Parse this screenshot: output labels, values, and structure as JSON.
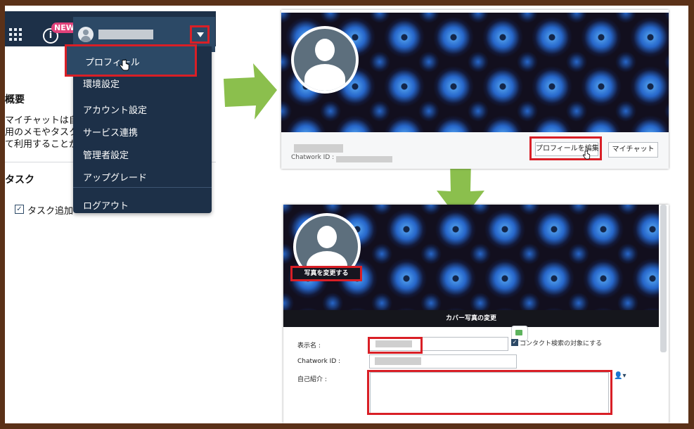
{
  "topbar": {
    "new_badge": "NEW",
    "info_icon_text": "i"
  },
  "menu": {
    "items": [
      "プロフィール",
      "環境設定",
      "アカウント設定",
      "サービス連携",
      "管理者設定",
      "アップグレード",
      "ログアウト"
    ]
  },
  "background": {
    "overview_heading": "概要",
    "description_lines": [
      "マイチャットは自",
      "用のメモやタスク",
      "て利用することが"
    ],
    "task_heading": "タスク",
    "task_add": "タスク追加"
  },
  "profile_view": {
    "chatwork_id_label": "Chatwork ID :",
    "edit_profile_button": "プロフィールを編集",
    "my_chat_button": "マイチャット"
  },
  "profile_edit": {
    "change_photo_button": "写真を変更する",
    "change_cover_button": "カバー写真の変更",
    "display_name_label": "表示名 :",
    "chatwork_id_label": "Chatwork ID :",
    "self_intro_label": "自己紹介 :",
    "contact_search_option": "コンタクト検索の対象にする"
  },
  "colors": {
    "annotation_red": "#d91f26",
    "arrow_green": "#8bbf4d",
    "header_navy": "#1d3048"
  }
}
